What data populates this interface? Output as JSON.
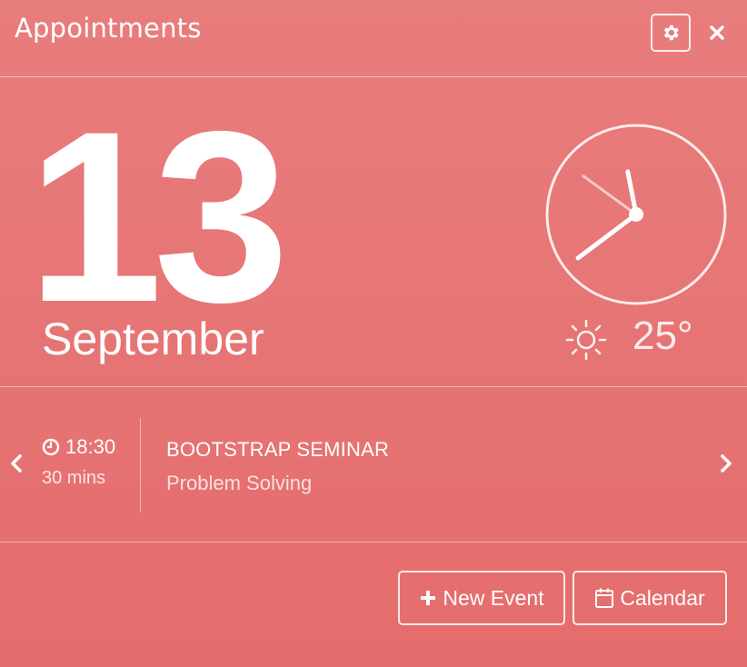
{
  "header": {
    "title": "Appointments",
    "settings_icon": "gear-icon",
    "close_icon": "close-icon"
  },
  "date": {
    "day": "13",
    "month": "September"
  },
  "clock": {
    "hour": 11,
    "minute": 38,
    "second": 51
  },
  "weather": {
    "icon": "sun-icon",
    "temperature": "25°"
  },
  "event": {
    "time": "18:30",
    "duration": "30 mins",
    "title": "BOOTSTRAP SEMINAR",
    "subtitle": "Problem Solving",
    "time_icon": "clock-icon",
    "prev_icon": "chevron-left-icon",
    "next_icon": "chevron-right-icon"
  },
  "actions": {
    "new_event_label": "New Event",
    "calendar_label": "Calendar"
  },
  "colors": {
    "background_top": "#e87d7d",
    "background_bottom": "#e56c6d",
    "foreground": "#ffffff"
  }
}
